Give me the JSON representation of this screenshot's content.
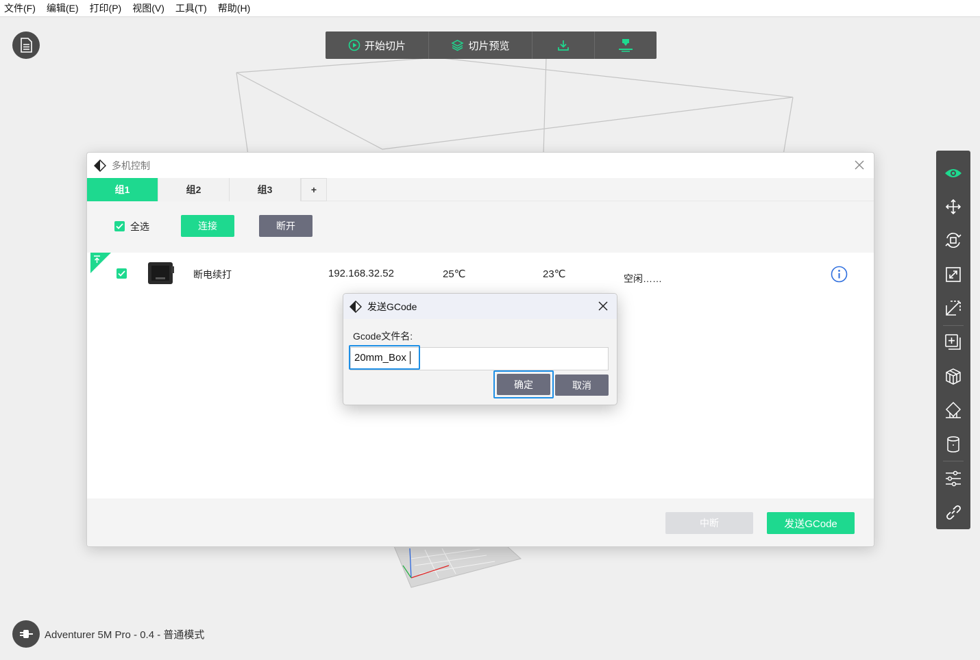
{
  "menu": {
    "items": [
      "文件(F)",
      "编辑(E)",
      "打印(P)",
      "视图(V)",
      "工具(T)",
      "帮助(H)"
    ]
  },
  "toolbar": {
    "slice_label": "开始切片",
    "preview_label": "切片预览"
  },
  "status_bar": {
    "printer_label": "Adventurer 5M Pro - 0.4 - 普通模式"
  },
  "multi_dialog": {
    "title": "多机控制",
    "tabs": [
      {
        "label": "组1",
        "active": true
      },
      {
        "label": "组2",
        "active": false
      },
      {
        "label": "组3",
        "active": false
      }
    ],
    "add_tab_label": "+",
    "select_all_label": "全选",
    "connect_label": "连接",
    "disconnect_label": "断开",
    "rows": [
      {
        "name": "断电续打",
        "ip": "192.168.32.52",
        "nozzle_temp": "25℃",
        "bed_temp": "23℃",
        "status": "空闲……"
      }
    ],
    "abort_label": "中断",
    "send_label": "发送GCode"
  },
  "send_dialog": {
    "title": "发送GCode",
    "field_label": "Gcode文件名:",
    "field_value": "20mm_Box",
    "ok_label": "确定",
    "cancel_label": "取消"
  },
  "colors": {
    "accent": "#1ed98f",
    "dark_panel": "#4a4a4a",
    "neutral_button": "#6b6d7d",
    "focus_ring": "#1e8fe6",
    "info_icon": "#2f6fde"
  }
}
